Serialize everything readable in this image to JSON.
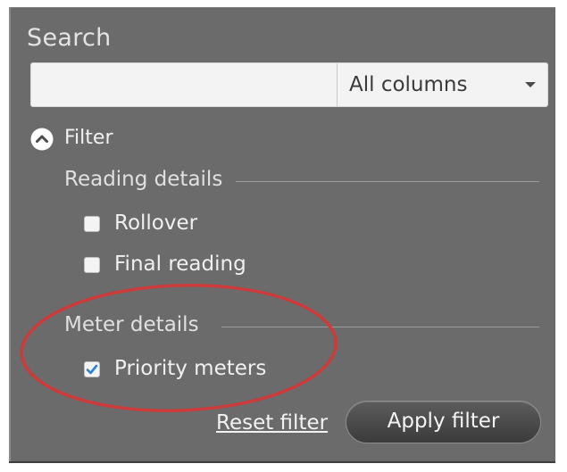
{
  "search": {
    "title": "Search",
    "input_value": "",
    "column_select": "All columns"
  },
  "filter": {
    "toggle_label": "Filter",
    "sections": [
      {
        "heading": "Reading details",
        "options": [
          {
            "label": "Rollover",
            "checked": false
          },
          {
            "label": "Final reading",
            "checked": false
          }
        ]
      },
      {
        "heading": "Meter details",
        "options": [
          {
            "label": "Priority meters",
            "checked": true
          }
        ]
      }
    ],
    "reset_label": "Reset filter",
    "apply_label": "Apply filter"
  },
  "colors": {
    "panel_bg": "#6b6b6b",
    "annotation": "#cc3a3a",
    "checkbox_check": "#2f7fd6"
  },
  "icons": {
    "collapse": "chevron-up-circle-icon",
    "dropdown": "chevron-down-icon",
    "check": "checkmark-icon"
  }
}
